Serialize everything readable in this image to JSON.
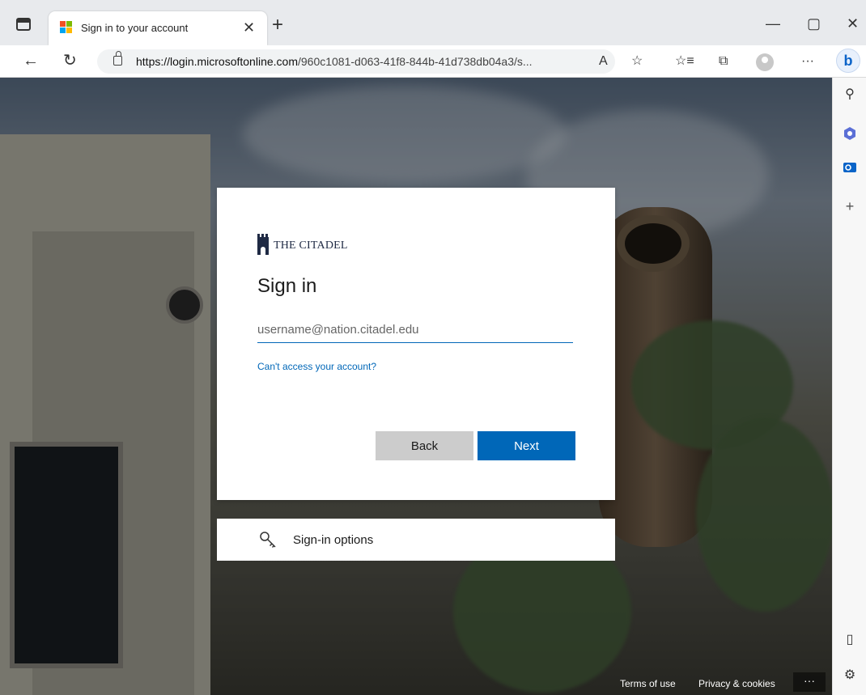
{
  "tab": {
    "title": "Sign in to your account",
    "close_glyph": "✕",
    "new_tab_glyph": "+"
  },
  "window": {
    "minimize": "—",
    "maximize": "▢",
    "close": "✕"
  },
  "nav": {
    "back_glyph": "←",
    "reload_glyph": "↻"
  },
  "address": {
    "domain": "https://login.microsoftonline.com",
    "path": "/960c1081-d063-41f8-844b-41d738db04a3/s..."
  },
  "toolbar": {
    "read_aloud": "A",
    "favorite": "☆",
    "favorites": "☆≡",
    "collections": "⧉",
    "more": "···",
    "bing": "b"
  },
  "sidebar": {
    "search": "⚲",
    "add": "+",
    "split": "▯",
    "settings": "⚙"
  },
  "brand": {
    "microsoft_colors": [
      "#f25022",
      "#7fba00",
      "#00a4ef",
      "#ffb900"
    ],
    "accent": "#0067b8"
  },
  "signin": {
    "org_name": "THE CITADEL",
    "title": "Sign in",
    "email_placeholder": "username@nation.citadel.edu",
    "help_link": "Can't access your account?",
    "back_label": "Back",
    "next_label": "Next"
  },
  "options": {
    "label": "Sign-in options"
  },
  "footer": {
    "terms": "Terms of use",
    "privacy": "Privacy & cookies",
    "more": "···"
  }
}
